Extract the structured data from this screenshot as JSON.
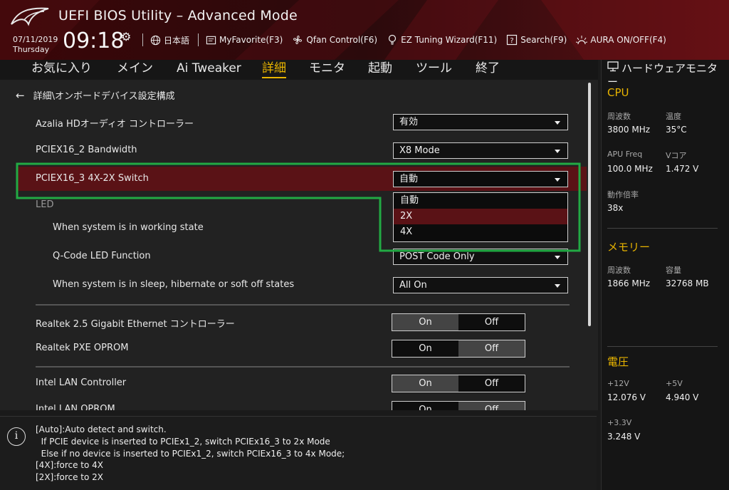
{
  "header": {
    "title": "UEFI BIOS Utility – Advanced Mode",
    "date": "07/11/2019",
    "day": "Thursday",
    "time": "09:18",
    "tools": [
      {
        "icon": "globe-icon",
        "label": "日本語"
      },
      {
        "icon": "favorite-icon",
        "label": "MyFavorite(F3)"
      },
      {
        "icon": "fan-icon",
        "label": "Qfan Control(F6)"
      },
      {
        "icon": "bulb-icon",
        "label": "EZ Tuning Wizard(F11)"
      },
      {
        "icon": "search-icon",
        "label": "Search(F9)"
      },
      {
        "icon": "aura-icon",
        "label": "AURA ON/OFF(F4)"
      }
    ]
  },
  "menu": {
    "items": [
      "お気に入り",
      "メイン",
      "Ai Tweaker",
      "詳細",
      "モニタ",
      "起動",
      "ツール",
      "終了"
    ],
    "active": "詳細"
  },
  "main": {
    "breadcrumb": "詳細\\オンボードデバイス設定構成",
    "rows": {
      "azalia": {
        "label": "Azalia HDオーディオ コントローラー",
        "value": "有効"
      },
      "pciex16_2": {
        "label": "PCIEX16_2 Bandwidth",
        "value": "X8 Mode"
      },
      "pciex16_3": {
        "label": "PCIEX16_3 4X-2X Switch",
        "value": "自動"
      },
      "led_header": {
        "label": "LED"
      },
      "working": {
        "label": "When system is in working state"
      },
      "qcode": {
        "label": "Q-Code LED Function",
        "value": "POST Code Only"
      },
      "sleep": {
        "label": "When system is in sleep, hibernate or soft off states",
        "value": "All On"
      },
      "realtek_eth": {
        "label": "Realtek 2.5 Gigabit Ethernet コントローラー",
        "on": "On",
        "off": "Off",
        "selected": "On"
      },
      "realtek_pxe": {
        "label": "Realtek PXE OPROM",
        "on": "On",
        "off": "Off",
        "selected": "Off"
      },
      "intel_lan": {
        "label": "Intel LAN Controller",
        "on": "On",
        "off": "Off",
        "selected": "On"
      },
      "intel_oprom": {
        "label": "Intel LAN OPROM",
        "on": "On",
        "off": "Off",
        "selected": "Off"
      }
    },
    "dropdown": {
      "options": [
        "自動",
        "2X",
        "4X"
      ],
      "highlighted": "2X"
    }
  },
  "help": {
    "lines": [
      "[Auto]:Auto detect and switch.",
      "  If PCIE device is inserted to PCIEx1_2, switch PCIEx16_3 to 2x Mode",
      "  Else if no device is inserted to PCIEx1_2, switch PCIEx16_3 to 4x Mode;",
      "[4X]:force to 4X",
      "[2X]:force to 2X"
    ]
  },
  "monitor": {
    "title": "ハードウェアモニター",
    "cpu": {
      "title": "CPU",
      "freq_label": "周波数",
      "freq": "3800 MHz",
      "temp_label": "温度",
      "temp": "35°C",
      "apu_label": "APU Freq",
      "apu": "100.0 MHz",
      "vcore_label": "Vコア",
      "vcore": "1.472 V",
      "ratio_label": "動作倍率",
      "ratio": "38x"
    },
    "memory": {
      "title": "メモリー",
      "freq_label": "周波数",
      "freq": "1866 MHz",
      "cap_label": "容量",
      "cap": "32768 MB"
    },
    "voltage": {
      "title": "電圧",
      "v12_label": "+12V",
      "v12": "12.076 V",
      "v5_label": "+5V",
      "v5": "4.940 V",
      "v33_label": "+3.3V",
      "v33": "3.248 V"
    }
  },
  "colors": {
    "accent": "#e8b400",
    "highlight": "#5a1216",
    "annotation": "#22aa44"
  }
}
